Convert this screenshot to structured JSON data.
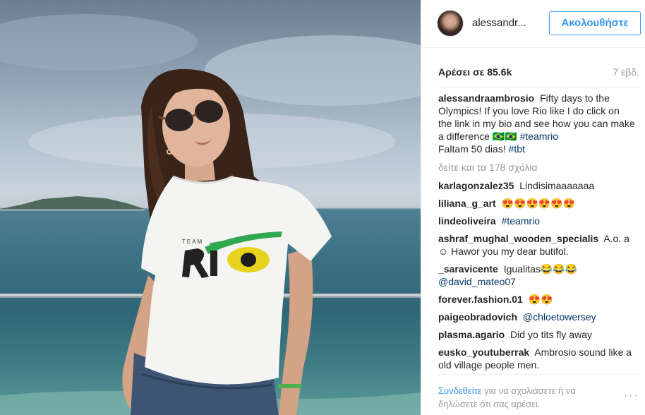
{
  "post": {
    "username": "alessandr...",
    "follow_label": "Ακολουθήστε",
    "likes": "Αρέσει σε 85.6k",
    "age": "7 εβδ.",
    "caption": {
      "user": "alessandraambrosio",
      "text": "Fifty days to the Olympics! If you love Rio like I do click on the link in my bio and see how you can make a difference 🇧🇷🇧🇷",
      "tag1": "#teamrio",
      "text2": "Faltam 50 dias!",
      "tag2": "#tbt"
    },
    "view_all": "δείτε και τα 178 σχόλια",
    "comments": [
      {
        "user": "karlagonzalez35",
        "text": "Lindisimaaaaaaa"
      },
      {
        "user": "liliana_g_art",
        "text": "😍😍😍😍😍😍"
      },
      {
        "user": "lindeoliveira",
        "tag": "#teamrio"
      },
      {
        "user": "ashraf_mughal_wooden_specialis",
        "text": "A.o. a ☺ Hawor you my dear butifol."
      },
      {
        "user": "_saravicente",
        "text": "Igualitas😂😂😂",
        "tag": "@david_mateo07"
      },
      {
        "user": "forever.fashion.01",
        "text": "😍😍"
      },
      {
        "user": "paigeobradovich",
        "tag": "@chloetowersey"
      },
      {
        "user": "plasma.agario",
        "text": "Did yo tits fly away"
      },
      {
        "user": "eusko_youtuberrak",
        "text": "Ambrosio sound like a old village people men."
      }
    ],
    "footer": {
      "login_label": "Συνδεθείτε",
      "text": "για να σχολιάσετε ή να δηλώσετε ότι σας αρέσει."
    },
    "more_icon": "···"
  },
  "colors": {
    "accent": "#3897f0",
    "tag": "#003569",
    "muted": "#999999",
    "text": "#262626"
  }
}
